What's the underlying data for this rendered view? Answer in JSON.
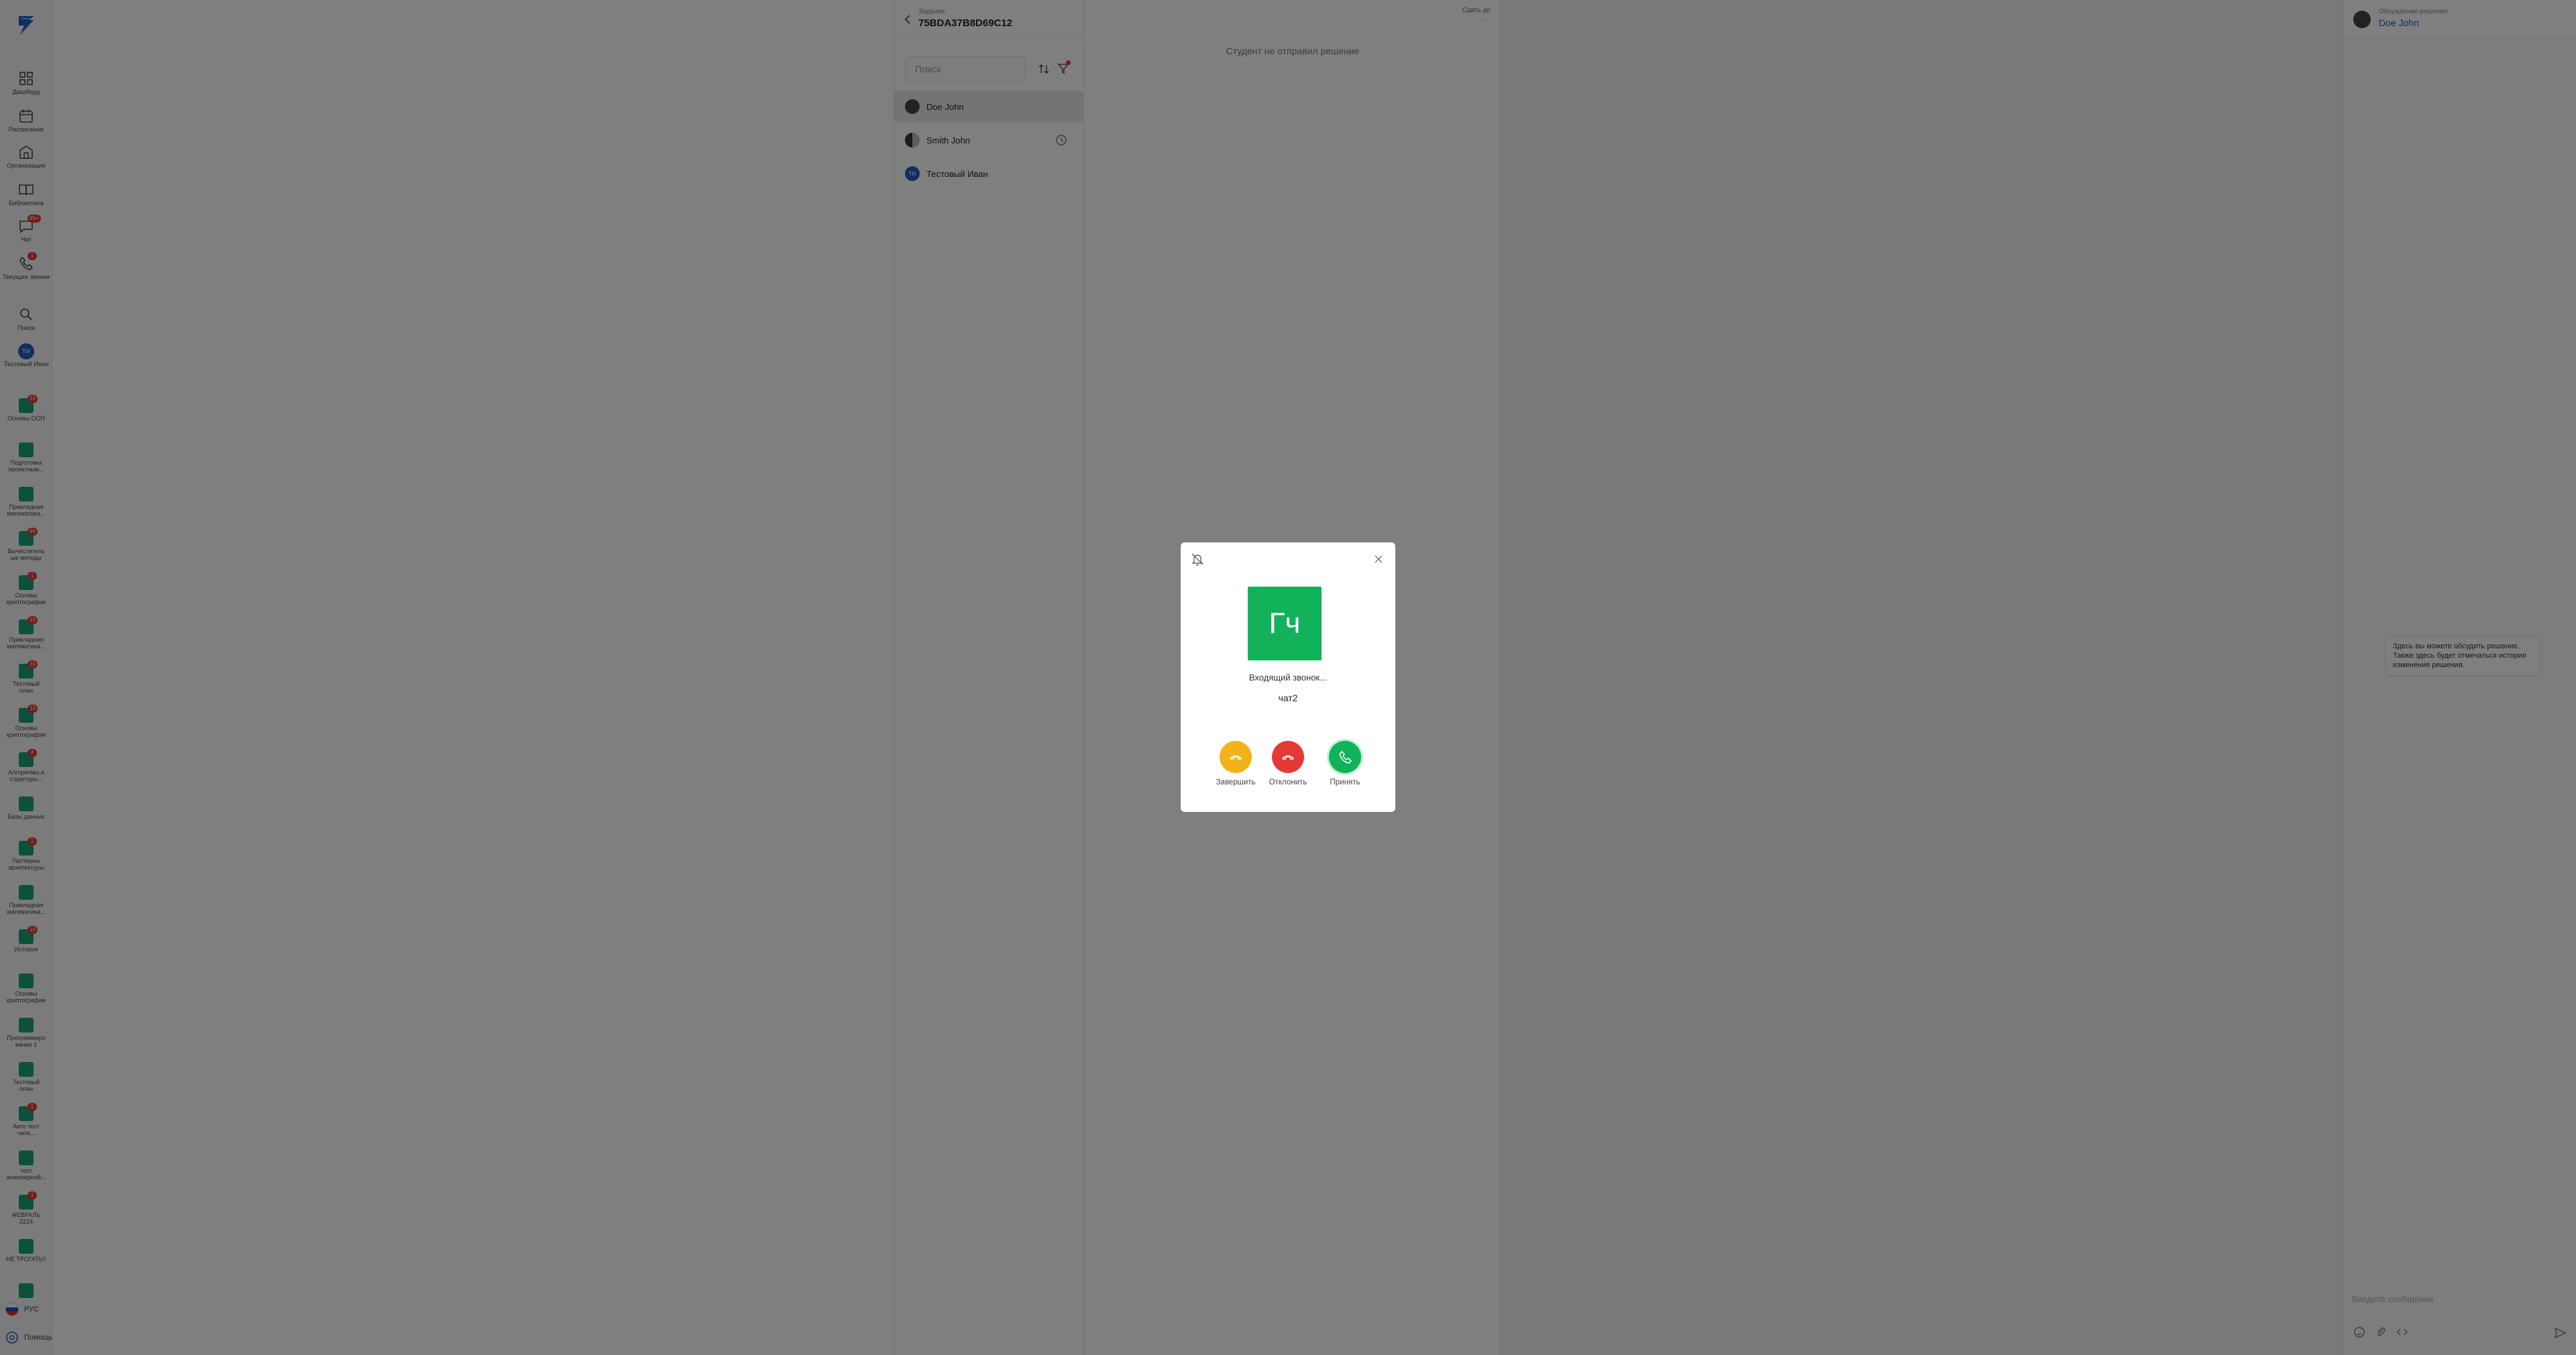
{
  "sidebar": {
    "nav": [
      {
        "label": "Дашборд",
        "icon": "dashboard-icon"
      },
      {
        "label": "Расписание",
        "icon": "calendar-icon"
      },
      {
        "label": "Организация",
        "icon": "building-icon"
      },
      {
        "label": "Библиотека",
        "icon": "book-icon"
      },
      {
        "label": "Чат",
        "icon": "chat-icon",
        "badge": "99+"
      },
      {
        "label": "Текущие звонки",
        "icon": "phone-icon",
        "badge": "1"
      },
      {
        "label": "Поиск",
        "icon": "search-icon"
      },
      {
        "label": "Тестовый Иван",
        "icon": "user-avatar",
        "initials": "ТИ"
      }
    ],
    "courses": [
      {
        "label": "Основы ООП",
        "badge": "10"
      },
      {
        "label": "Подготовка\nпроектным...",
        "badge": ""
      },
      {
        "label": "Прикладная\nматематика...",
        "badge": ""
      },
      {
        "label": "Вычислитель\nые методы",
        "badge": "99"
      },
      {
        "label": "Основы\nкриптографии",
        "badge": "1"
      },
      {
        "label": "Прикладная\nматематика...",
        "badge": "10"
      },
      {
        "label": "Тестовый\nплан",
        "badge": "10"
      },
      {
        "label": "Основы\nкриптографии",
        "badge": "10"
      },
      {
        "label": "Алгоритмы и\nструктуры...",
        "badge": "4"
      },
      {
        "label": "Базы данных",
        "badge": ""
      },
      {
        "label": "Паттерны\nархитектуры",
        "badge": "1"
      },
      {
        "label": "Прикладная\nматематика...",
        "badge": ""
      },
      {
        "label": "История",
        "badge": "10"
      },
      {
        "label": "Основы\nкриптографии",
        "badge": ""
      },
      {
        "label": "Программиро\nвание 1",
        "badge": ""
      },
      {
        "label": "Тестовый\nплан",
        "badge": ""
      },
      {
        "label": "Авто тест\nчата...",
        "badge": "1"
      },
      {
        "label": "тест\nинженерной...",
        "badge": ""
      },
      {
        "label": "ФЕВРАЛЬ\n2224",
        "badge": "1"
      },
      {
        "label": "НЕ ТРОГАТЬ!!",
        "badge": ""
      },
      {
        "label": "",
        "badge": ""
      }
    ],
    "language": "РУС",
    "help": "Помощь"
  },
  "task": {
    "subtitle": "Задание",
    "title": "75BDA37B8D69C12",
    "search_placeholder": "Поиск",
    "students": [
      {
        "name": "Doe John",
        "initials": "",
        "active": true
      },
      {
        "name": "Smith John",
        "initials": "",
        "active": false
      },
      {
        "name": "Тестовый Иван",
        "initials": "ТИ",
        "active": false
      }
    ]
  },
  "solution": {
    "empty_text": "Студент не отправил решение",
    "deadline_label": "Сдать до",
    "deadline_value": "-"
  },
  "chat": {
    "subtitle": "Обсуждение решения",
    "name": "Doe John",
    "hint": "Здесь вы можете обсудить решение. Также здесь будет отмечаться история изменения решения.",
    "input_placeholder": "Введите сообщение"
  },
  "call": {
    "avatar_initials": "Гч",
    "status": "Входящий звонок...",
    "caller": "чат2",
    "buttons": [
      {
        "label": "Завершить",
        "color": "#f2b318"
      },
      {
        "label": "Отклонить",
        "color": "#e53935"
      },
      {
        "label": "Принять",
        "color": "#12b25a"
      }
    ]
  },
  "colors": {
    "accent": "#1f5fbf",
    "course": "#1aa37a",
    "overlay": "rgba(0,0,0,0.5)"
  }
}
